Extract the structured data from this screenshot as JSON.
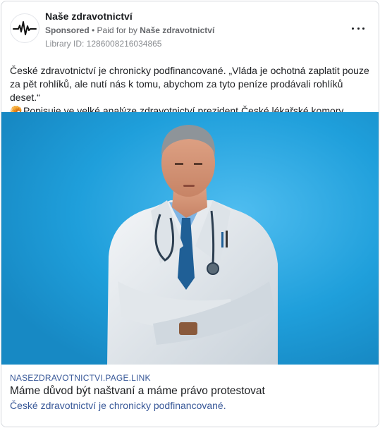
{
  "header": {
    "page_name": "Naše zdravotnictví",
    "sponsored_label": "Sponsored",
    "separator": " • ",
    "paid_for_by_label": "Paid for by ",
    "payer_name": "Naše zdravotnictví",
    "library_id": "Library ID: 1286008216034865",
    "avatar_icon": "heartbeat-icon",
    "more_icon": "more-options-icon"
  },
  "post": {
    "line1": "České zdravotnictví je chronicky podfinancované. „Vláda je ochotná zaplatit pouze za pět rohlíků, ale nutí nás k tomu, abychom za tyto peníze prodávali rohlíků deset.“",
    "emoji": "🥐",
    "line2": "Popisuje ve velké analýze zdravotnictví prezident České lékařské komory."
  },
  "image": {
    "description_icon": "doctor-photo",
    "background_color": "#1f9fdb"
  },
  "link": {
    "domain": "NASEZDRAVOTNICTVI.PAGE.LINK",
    "headline": "Máme důvod být naštvaní a máme právo protestovat",
    "description": "České zdravotnictví je chronicky podfinancované."
  }
}
